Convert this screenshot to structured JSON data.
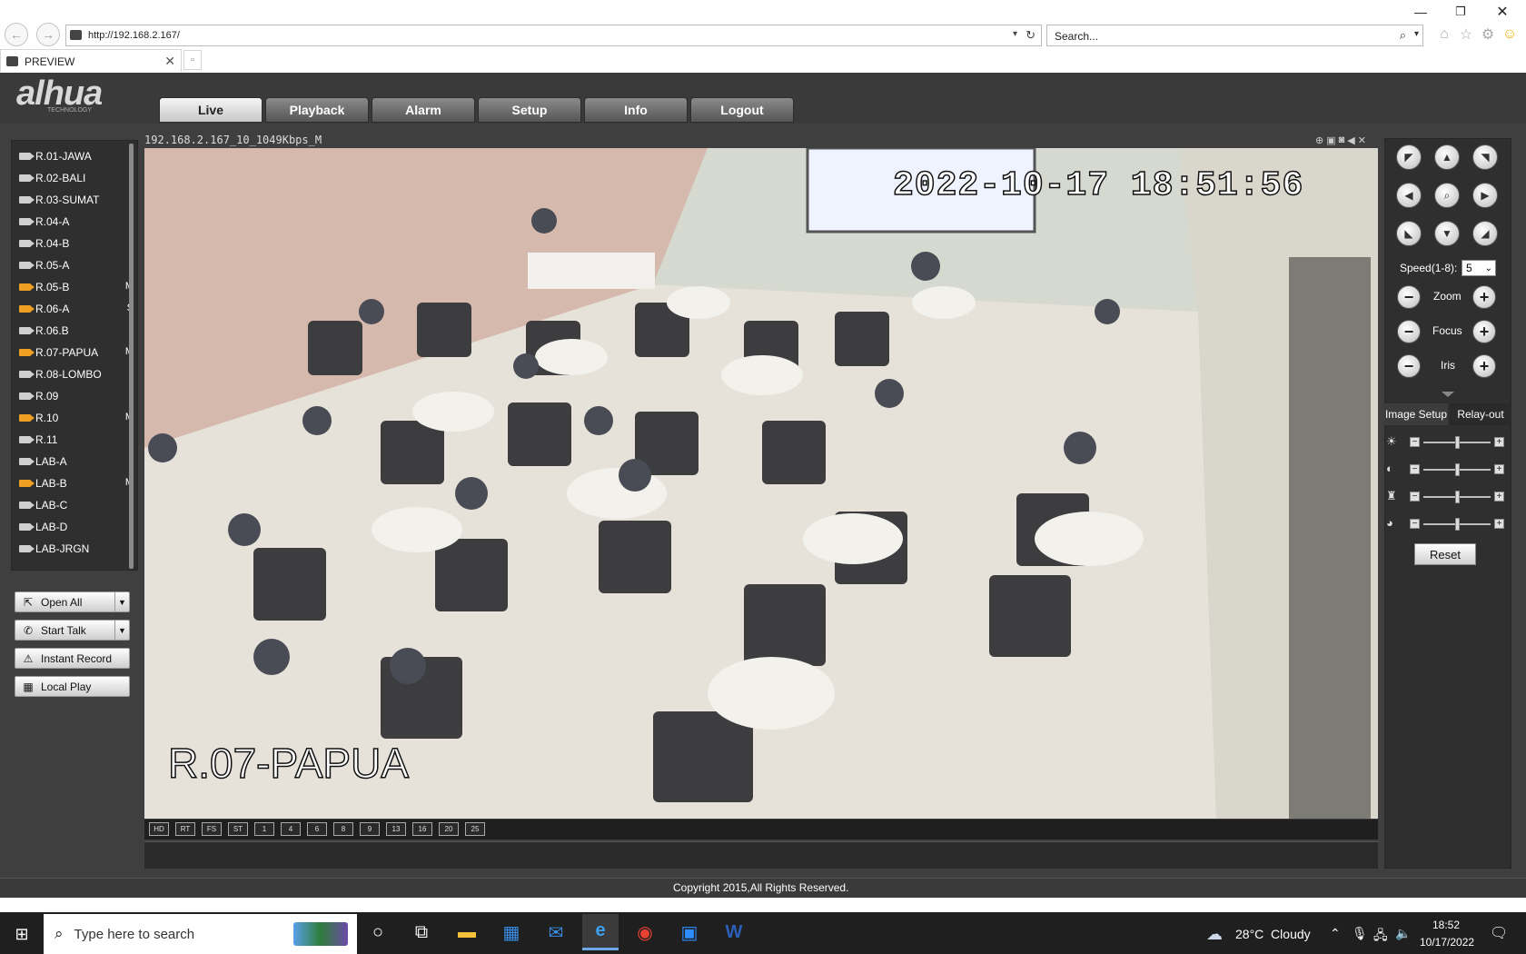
{
  "browser": {
    "url": "http://192.168.2.167/",
    "search_placeholder": "Search...",
    "tab_title": "PREVIEW",
    "window_controls": [
      "minimize-icon",
      "restore-icon",
      "close-icon"
    ],
    "toolbar_icons": [
      "home-icon",
      "star-icon",
      "gear-icon",
      "smiley-icon"
    ]
  },
  "app": {
    "logo": "alhua",
    "logo_sub": "TECHNOLOGY",
    "nav": [
      "Live",
      "Playback",
      "Alarm",
      "Setup",
      "Info",
      "Logout"
    ],
    "active_tab": "Live"
  },
  "cameras": [
    {
      "name": "R.01-JAWA",
      "on": false,
      "flag": ""
    },
    {
      "name": "R.02-BALI",
      "on": false,
      "flag": ""
    },
    {
      "name": "R.03-SUMAT",
      "on": false,
      "flag": ""
    },
    {
      "name": "R.04-A",
      "on": false,
      "flag": ""
    },
    {
      "name": "R.04-B",
      "on": false,
      "flag": ""
    },
    {
      "name": "R.05-A",
      "on": false,
      "flag": ""
    },
    {
      "name": "R.05-B",
      "on": true,
      "flag": "M"
    },
    {
      "name": "R.06-A",
      "on": true,
      "flag": "S"
    },
    {
      "name": "R.06.B",
      "on": false,
      "flag": ""
    },
    {
      "name": "R.07-PAPUA",
      "on": true,
      "flag": "M"
    },
    {
      "name": "R.08-LOMBO",
      "on": false,
      "flag": ""
    },
    {
      "name": "R.09",
      "on": false,
      "flag": ""
    },
    {
      "name": "R.10",
      "on": true,
      "flag": "M"
    },
    {
      "name": "R.11",
      "on": false,
      "flag": ""
    },
    {
      "name": "LAB-A",
      "on": false,
      "flag": ""
    },
    {
      "name": "LAB-B",
      "on": true,
      "flag": "M"
    },
    {
      "name": "LAB-C",
      "on": false,
      "flag": ""
    },
    {
      "name": "LAB-D",
      "on": false,
      "flag": ""
    },
    {
      "name": "LAB-JRGN",
      "on": false,
      "flag": ""
    }
  ],
  "left_buttons": {
    "open_all": "Open All",
    "start_talk": "Start Talk",
    "instant_record": "Instant Record",
    "local_play": "Local Play"
  },
  "video": {
    "stream_info": "192.168.2.167_10_1049Kbps_M",
    "timestamp": "2022-10-17 18:51:56",
    "camera_label": "R.07-PAPUA",
    "layout_buttons": [
      "HD",
      "RT",
      "FS",
      "ST",
      "1",
      "4",
      "6",
      "8",
      "9",
      "13",
      "16",
      "20",
      "25"
    ]
  },
  "ptz": {
    "speed_label": "Speed(1-8):",
    "speed_value": "5",
    "zoom_label": "Zoom",
    "focus_label": "Focus",
    "iris_label": "Iris",
    "tabs": [
      "Image Setup",
      "Relay-out"
    ],
    "reset_label": "Reset",
    "image_levels": [
      0.5,
      0.5,
      0.5,
      0.5
    ]
  },
  "footer": {
    "copyright": "Copyright 2015,All Rights Reserved."
  },
  "taskbar": {
    "search_placeholder": "Type here to search",
    "weather": "28°C  Cloudy",
    "time": "18:52",
    "date": "10/17/2022"
  }
}
